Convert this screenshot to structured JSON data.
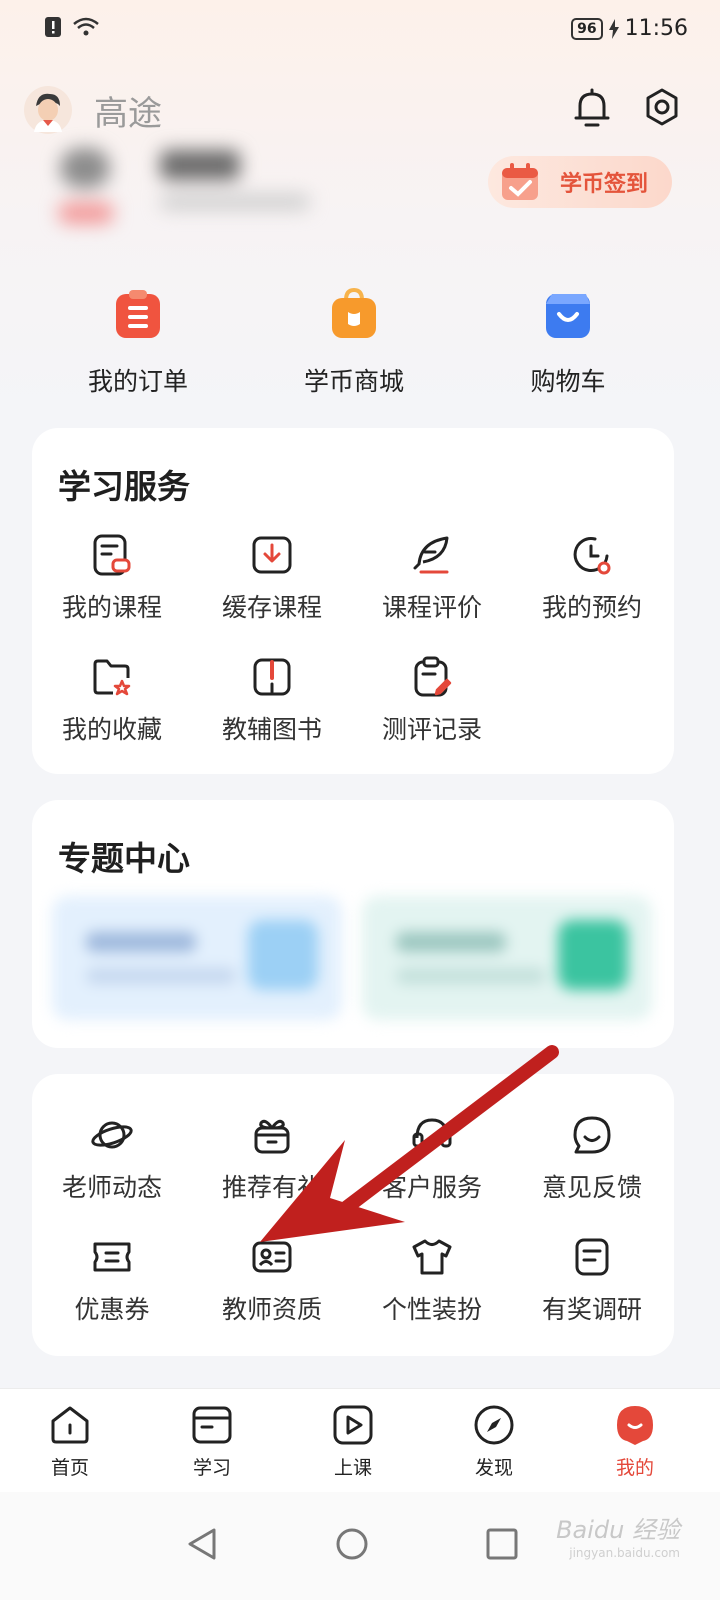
{
  "status_bar": {
    "battery": "96",
    "time": "11:56"
  },
  "header": {
    "title": "高途"
  },
  "checkin": {
    "label": "学币签到"
  },
  "quick_actions": [
    {
      "label": "我的订单",
      "icon": "order-clipboard-icon",
      "color": "#f0543f"
    },
    {
      "label": "学币商城",
      "icon": "shopping-bag-icon",
      "color": "#f79a2c"
    },
    {
      "label": "购物车",
      "icon": "cart-bag-icon",
      "color": "#3d7bf0"
    }
  ],
  "study_services": {
    "title": "学习服务",
    "items": [
      {
        "label": "我的课程",
        "icon": "course-icon"
      },
      {
        "label": "缓存课程",
        "icon": "download-icon"
      },
      {
        "label": "课程评价",
        "icon": "feather-icon"
      },
      {
        "label": "我的预约",
        "icon": "clock-icon"
      },
      {
        "label": "我的收藏",
        "icon": "favorite-folder-icon"
      },
      {
        "label": "教辅图书",
        "icon": "book-icon"
      },
      {
        "label": "测评记录",
        "icon": "test-record-icon"
      }
    ]
  },
  "topic_center": {
    "title": "专题中心"
  },
  "more_services": {
    "items": [
      {
        "label": "老师动态",
        "icon": "planet-icon"
      },
      {
        "label": "推荐有礼",
        "icon": "gift-icon"
      },
      {
        "label": "客户服务",
        "icon": "headset-icon"
      },
      {
        "label": "意见反馈",
        "icon": "feedback-icon"
      },
      {
        "label": "优惠券",
        "icon": "coupon-icon"
      },
      {
        "label": "教师资质",
        "icon": "id-card-icon"
      },
      {
        "label": "个性装扮",
        "icon": "tshirt-icon"
      },
      {
        "label": "有奖调研",
        "icon": "survey-icon"
      }
    ]
  },
  "tabs": [
    {
      "label": "首页",
      "icon": "home-icon"
    },
    {
      "label": "学习",
      "icon": "study-icon"
    },
    {
      "label": "上课",
      "icon": "play-icon"
    },
    {
      "label": "发现",
      "icon": "compass-icon"
    },
    {
      "label": "我的",
      "icon": "mine-icon",
      "active": true
    }
  ],
  "watermark": {
    "text": "Baidu 经验",
    "sub": "jingyan.baidu.com"
  },
  "colors": {
    "accent": "#e4483a",
    "arrow": "#c0201e"
  }
}
